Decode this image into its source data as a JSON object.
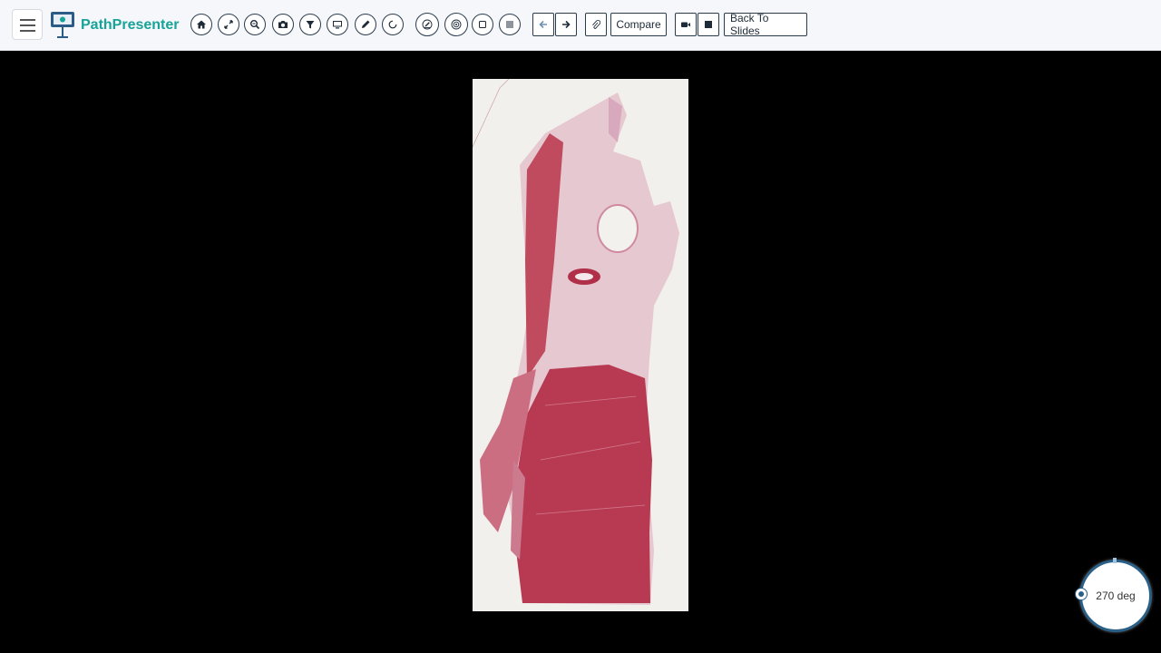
{
  "app": {
    "brand": "PathPresenter"
  },
  "toolbar": {
    "icons": [
      "home-icon",
      "fullscreen-icon",
      "zoom-icon",
      "camera-icon",
      "filter-icon",
      "monitor-icon",
      "pencil-icon",
      "rotate-icon",
      "annotate-icon",
      "target-icon",
      "square-icon",
      "list-icon",
      "arrow-left-icon",
      "arrow-right-icon",
      "paperclip-icon",
      "video-icon",
      "stop-icon"
    ],
    "compare_label": "Compare",
    "back_label": "Back To Slides"
  },
  "rotation": {
    "label": "270 deg"
  },
  "colors": {
    "brand": "#17a398",
    "dark": "#2a3b4c",
    "accent": "#2a5f87",
    "tissue": "#b8324c"
  }
}
